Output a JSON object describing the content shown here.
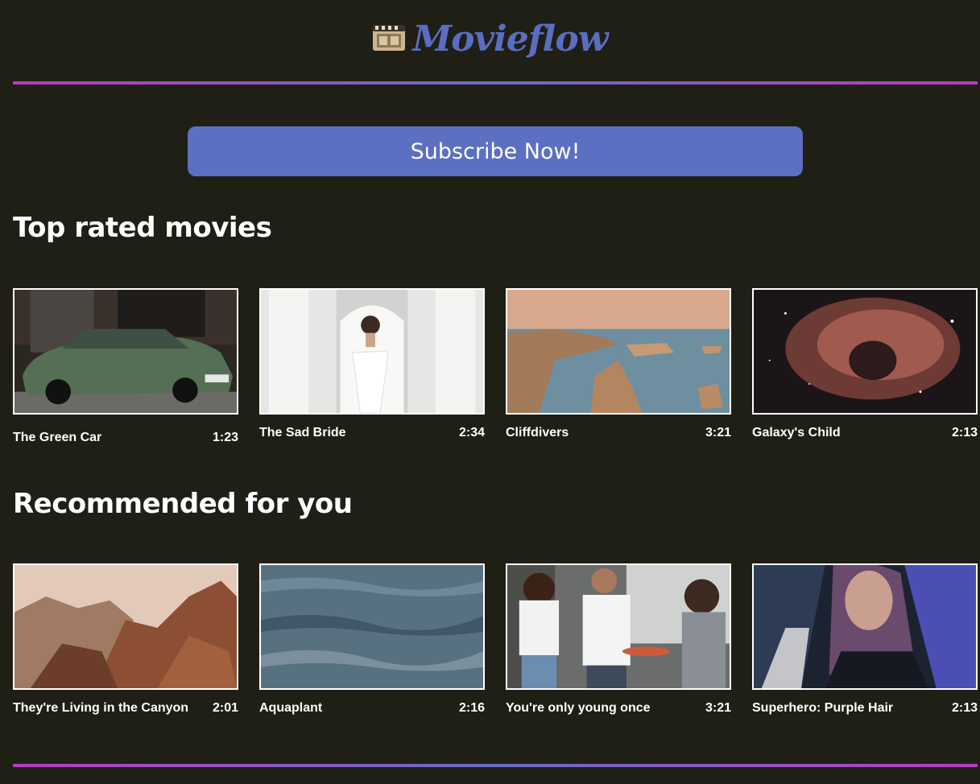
{
  "brand": {
    "name": "Movieflow",
    "logo_icon": "film-reel-icon",
    "accent": "#5b6dc0"
  },
  "cta": {
    "label": "Subscribe Now!"
  },
  "sections": [
    {
      "title": "Top rated movies",
      "movies": [
        {
          "title": "The Green Car",
          "duration": "1:23"
        },
        {
          "title": "The Sad Bride",
          "duration": "2:34"
        },
        {
          "title": "Cliffdivers",
          "duration": "3:21"
        },
        {
          "title": "Galaxy's Child",
          "duration": "2:13"
        }
      ]
    },
    {
      "title": "Recommended for you",
      "movies": [
        {
          "title": "They're Living in the Canyon",
          "duration": "2:01"
        },
        {
          "title": "Aquaplant",
          "duration": "2:16"
        },
        {
          "title": "You're only young once",
          "duration": "3:21"
        },
        {
          "title": "Superhero: Purple Hair",
          "duration": "2:13"
        }
      ]
    }
  ]
}
